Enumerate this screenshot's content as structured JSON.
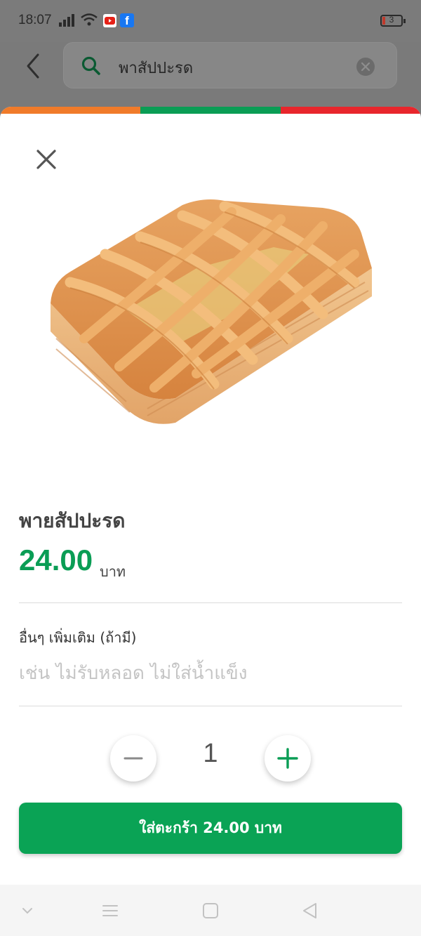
{
  "status_bar": {
    "time": "18:07",
    "battery": "3"
  },
  "search": {
    "query": "พาสัปปะรด"
  },
  "product": {
    "name": "พายสัปปะรด",
    "price": "24.00",
    "currency": "บาท",
    "image": "pineapple-pie-pastry"
  },
  "notes": {
    "label": "อื่นๆ เพิ่มเติม (ถ้ามี)",
    "placeholder": "เช่น ไม่รับหลอด ไม่ใส่น้ำแข็ง"
  },
  "quantity": {
    "value": "1"
  },
  "cart_button": {
    "label": "ใส่ตะกร้า 24.00 บาท"
  },
  "colors": {
    "brand_orange": "#f07b2a",
    "brand_green": "#0a9d55",
    "brand_red": "#e8262c"
  },
  "icons": [
    "back-arrow-icon",
    "search-icon",
    "clear-icon",
    "close-icon",
    "minus-icon",
    "plus-icon",
    "nav-down-icon",
    "nav-menu-icon",
    "nav-home-icon",
    "nav-back-icon"
  ]
}
